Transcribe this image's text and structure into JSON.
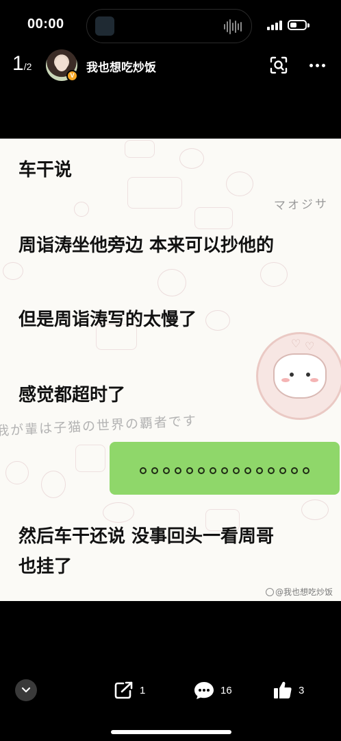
{
  "status_bar": {
    "time": "00:00",
    "battery_level": 0.45
  },
  "header": {
    "page_current": "1",
    "page_separator": "/",
    "page_total": "2",
    "username": "我也想吃炒饭",
    "verified_badge": "V",
    "icons": [
      "scan-icon",
      "more-icon"
    ]
  },
  "post": {
    "lines": [
      "车干说",
      "周诣涛坐他旁边 本来可以抄他的",
      "但是周诣涛写的太慢了",
      "感觉都超时了",
      "然后车干还说 没事回头一看周哥",
      "也挂了"
    ],
    "bubble_dots": 15,
    "bubble_color": "#8fd76a",
    "decor_katakana": "マオジサ",
    "decor_cursive": "我が輩は子猫の世界の覇者です",
    "watermark": "@我也想吃炒饭"
  },
  "bottom_bar": {
    "share_count": "1",
    "comment_count": "16",
    "like_count": "3",
    "icons": [
      "chevron-down-icon",
      "share-icon",
      "comment-icon",
      "thumbs-up-icon"
    ]
  }
}
